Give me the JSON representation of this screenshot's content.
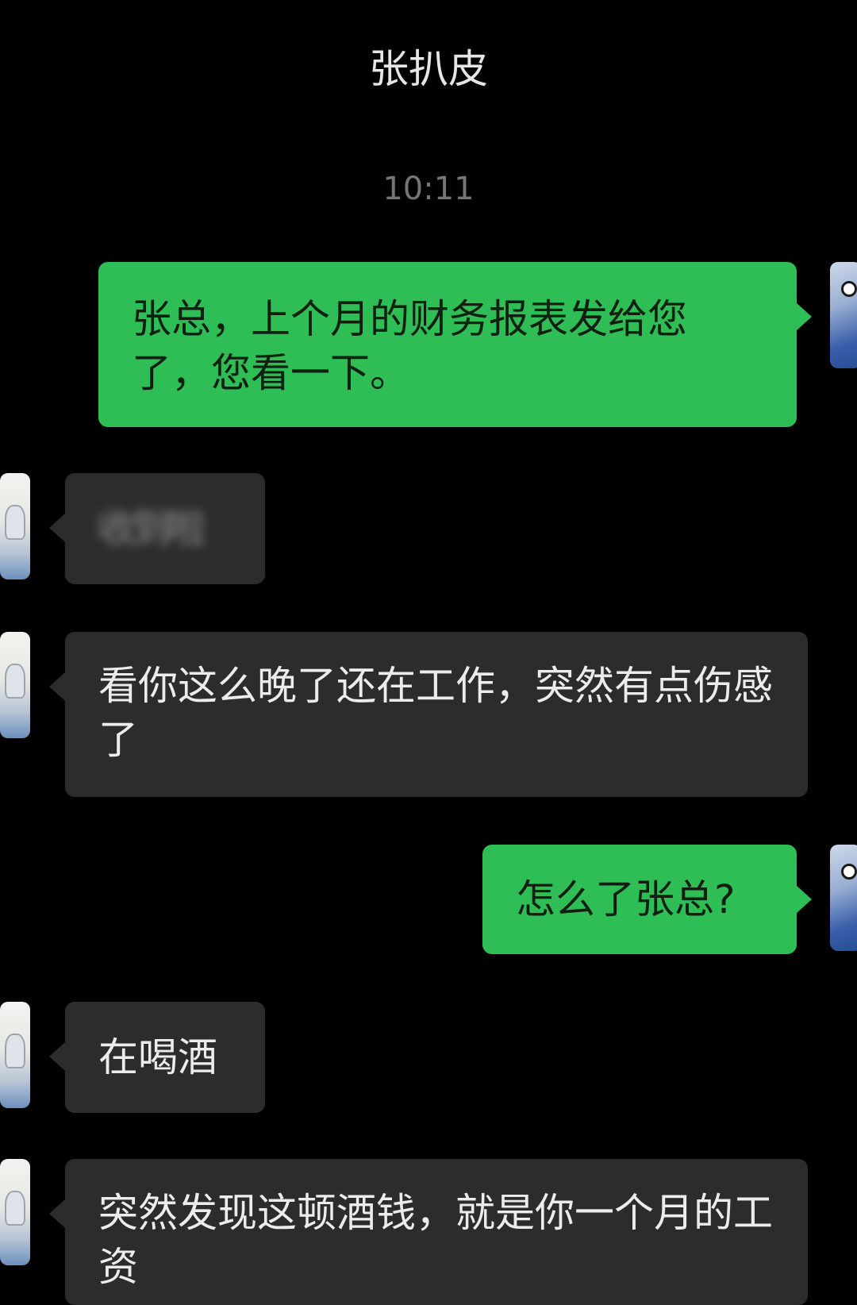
{
  "header": {
    "title": "张扒皮"
  },
  "timestamp": "10:11",
  "messages": [
    {
      "from": "me",
      "text": "张总，上个月的财务报表发给您了，您看一下。"
    },
    {
      "from": "other",
      "text": "收到啦",
      "obscured": true
    },
    {
      "from": "other",
      "text": "看你这么晚了还在工作，突然有点伤感了"
    },
    {
      "from": "me",
      "text": "怎么了张总?"
    },
    {
      "from": "other",
      "text": "在喝酒"
    },
    {
      "from": "other",
      "text": "突然发现这顿酒钱，就是你一个月的工资"
    }
  ],
  "colors": {
    "background": "#000000",
    "sent_bubble": "#2fbe55",
    "received_bubble": "#2c2c2c"
  }
}
